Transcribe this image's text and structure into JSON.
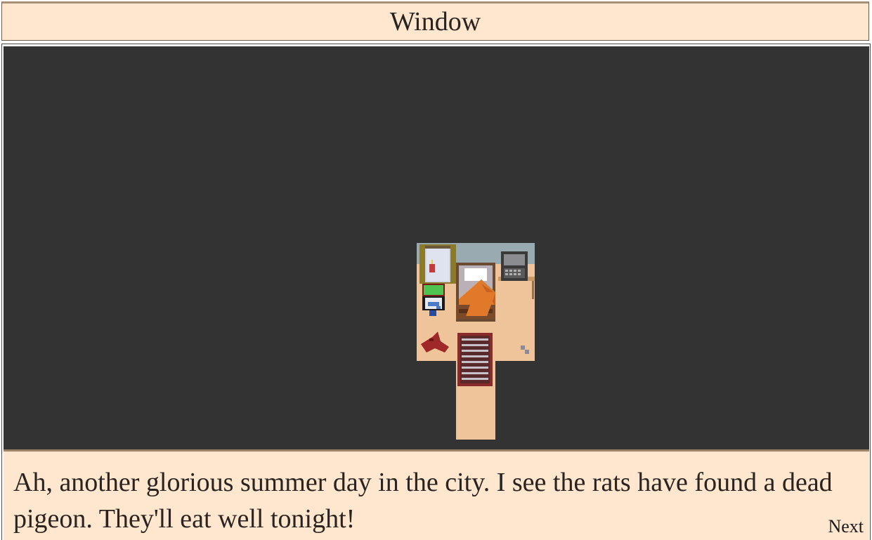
{
  "window": {
    "title": "Window"
  },
  "dialog": {
    "text": "Ah, another glorious summer day in the city. I see the rats have found a dead pigeon. They'll eat well tonight!",
    "next_label": "Next"
  },
  "colors": {
    "title_bg": "#ffe6cf",
    "viewport_bg": "#333333",
    "floor": "#f0c49a",
    "wall": "#99aab1",
    "text": "#2a2420"
  }
}
